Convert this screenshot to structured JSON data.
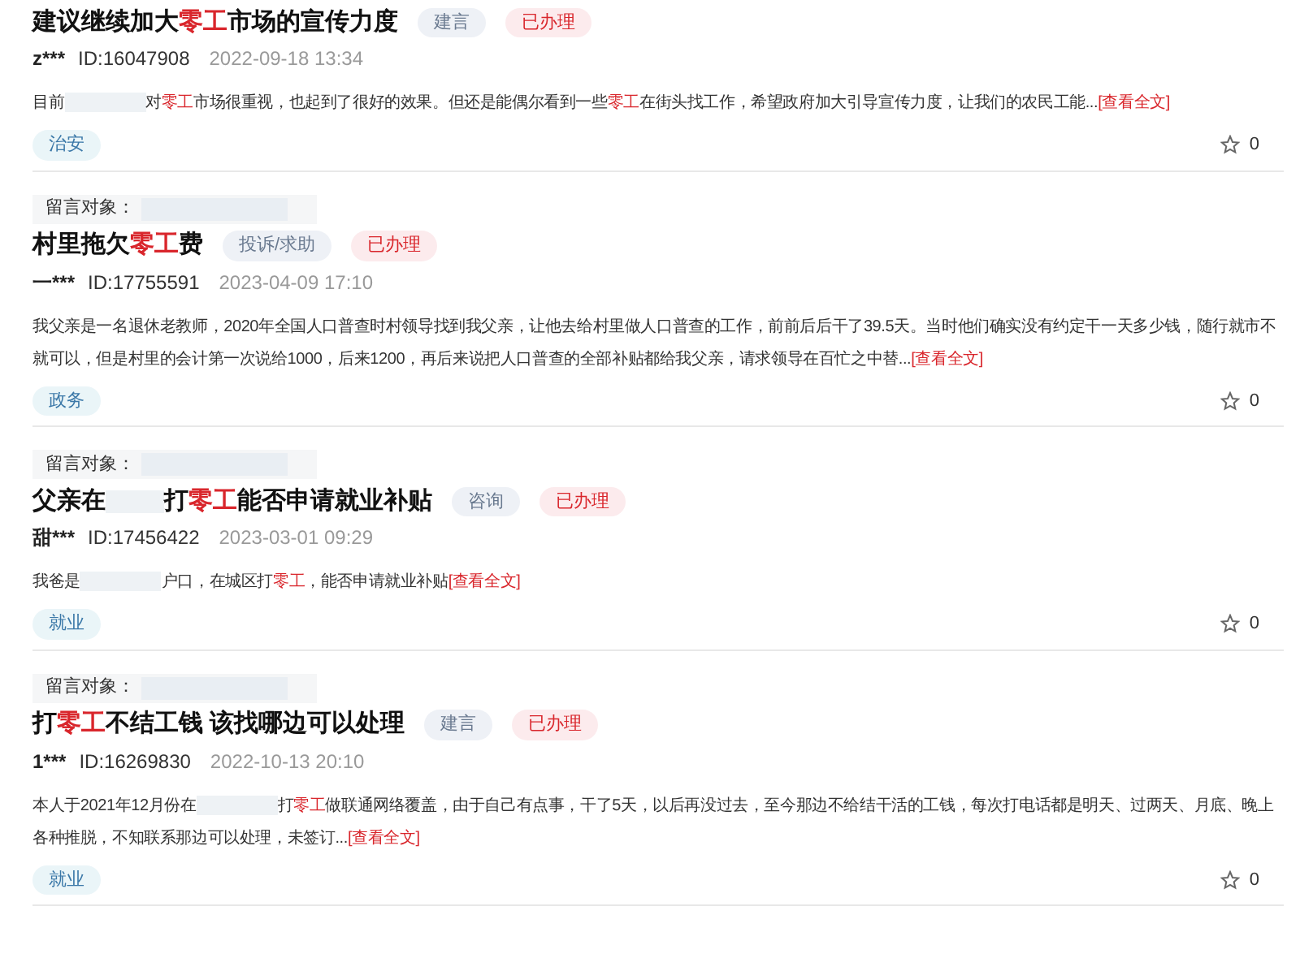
{
  "posts": [
    {
      "title": [
        {
          "kind": "text",
          "text": "建议继续加大"
        },
        {
          "kind": "highlight",
          "text": "零工"
        },
        {
          "kind": "text",
          "text": "市场的宣传力度"
        }
      ],
      "type_tag": "建言",
      "status_tag": "已办理",
      "author": "z***",
      "id": "ID:16047908",
      "time": "2022-09-18 13:34",
      "body": [
        {
          "kind": "text",
          "text": "目前"
        },
        {
          "kind": "redacted"
        },
        {
          "kind": "text",
          "text": "对"
        },
        {
          "kind": "highlight",
          "text": "零工"
        },
        {
          "kind": "text",
          "text": "市场很重视，也起到了很好的效果。但还是能偶尔看到一些"
        },
        {
          "kind": "highlight",
          "text": "零工"
        },
        {
          "kind": "text",
          "text": "在街头找工作，希望政府加大引导宣传力度，让我们的农民工能..."
        },
        {
          "kind": "link",
          "text": "[查看全文]"
        }
      ],
      "category": "治安",
      "likes": "0"
    },
    {
      "target_label": "留言对象：",
      "title": [
        {
          "kind": "text",
          "text": "村里拖欠"
        },
        {
          "kind": "highlight",
          "text": "零工"
        },
        {
          "kind": "text",
          "text": "费"
        }
      ],
      "type_tag": "投诉/求助",
      "status_tag": "已办理",
      "author": "一***",
      "id": "ID:17755591",
      "time": "2023-04-09 17:10",
      "body": [
        {
          "kind": "text",
          "text": "我父亲是一名退休老教师，2020年全国人口普查时村领导找到我父亲，让他去给村里做人口普查的工作，前前后后干了39.5天。当时他们确实没有约定干一天多少钱，随行就市不就可以，但是村里的会计第一次说给1000，后来1200，再后来说把人口普查的全部补贴都给我父亲，请求领导在百忙之中替..."
        },
        {
          "kind": "link",
          "text": "[查看全文]"
        }
      ],
      "category": "政务",
      "likes": "0"
    },
    {
      "target_label": "留言对象：",
      "title": [
        {
          "kind": "text",
          "text": "父亲在"
        },
        {
          "kind": "redacted"
        },
        {
          "kind": "text",
          "text": "打"
        },
        {
          "kind": "highlight",
          "text": "零工"
        },
        {
          "kind": "text",
          "text": "能否申请就业补贴"
        }
      ],
      "type_tag": "咨询",
      "status_tag": "已办理",
      "author": "甜***",
      "id": "ID:17456422",
      "time": "2023-03-01 09:29",
      "body": [
        {
          "kind": "text",
          "text": "我爸是"
        },
        {
          "kind": "redacted"
        },
        {
          "kind": "text",
          "text": "户口，在城区打"
        },
        {
          "kind": "highlight",
          "text": "零工"
        },
        {
          "kind": "text",
          "text": "，能否申请就业补贴"
        },
        {
          "kind": "link",
          "text": "[查看全文]"
        }
      ],
      "category": "就业",
      "likes": "0"
    },
    {
      "target_label": "留言对象：",
      "title": [
        {
          "kind": "text",
          "text": "打"
        },
        {
          "kind": "highlight",
          "text": "零工"
        },
        {
          "kind": "text",
          "text": "不结工钱 该找哪边可以处理"
        }
      ],
      "type_tag": "建言",
      "status_tag": "已办理",
      "author": "1***",
      "id": "ID:16269830",
      "time": "2022-10-13 20:10",
      "body": [
        {
          "kind": "text",
          "text": "本人于2021年12月份在"
        },
        {
          "kind": "redacted"
        },
        {
          "kind": "text",
          "text": "打"
        },
        {
          "kind": "highlight",
          "text": "零工"
        },
        {
          "kind": "text",
          "text": "做联通网络覆盖，由于自己有点事，干了5天，以后再没过去，至今那边不给结干活的工钱，每次打电话都是明天、过两天、月底、晚上各种推脱，不知联系那边可以处理，未签订..."
        },
        {
          "kind": "link",
          "text": "[查看全文]"
        }
      ],
      "category": "就业",
      "likes": "0"
    }
  ]
}
